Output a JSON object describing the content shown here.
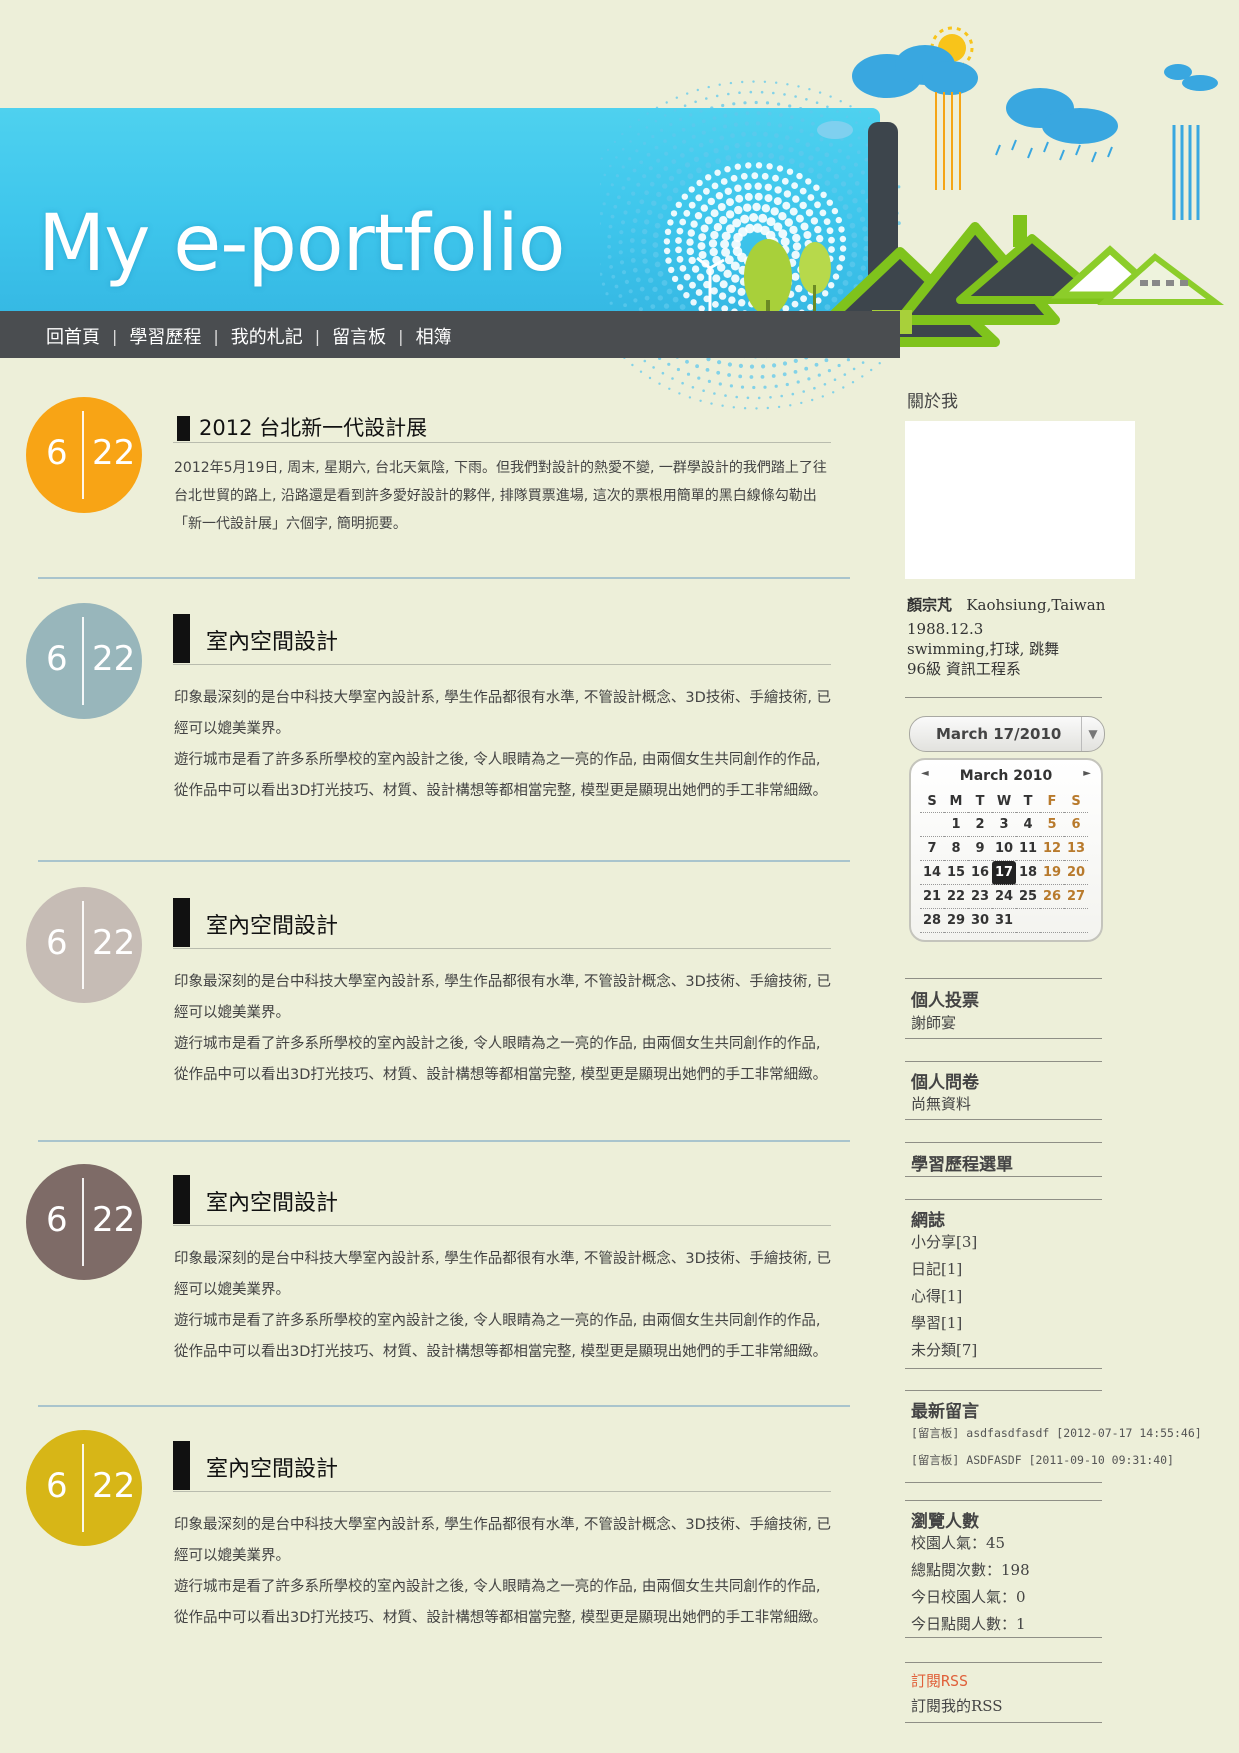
{
  "header": {
    "site_title": "My e-portfolio",
    "nav": [
      "回首頁",
      "學習歷程",
      "我的札記",
      "留言板",
      "相簿"
    ]
  },
  "posts": [
    {
      "month": "6",
      "day": "22",
      "color": "#f8a415",
      "title": "2012 台北新一代設計展",
      "paragraphs": [
        "2012年5月19日, 周末, 星期六, 台北天氣陰, 下雨。但我們對設計的熱愛不變, 一群學設計的我們踏上了往台北世貿的路上, 沿路還是看到許多愛好設計的夥伴, 排隊買票進場, 這次的票根用簡單的黑白線條勾勒出「新一代設計展」六個字, 簡明扼要。"
      ]
    },
    {
      "month": "6",
      "day": "22",
      "color": "#98b6bb",
      "title": "室內空間設計",
      "paragraphs": [
        "印象最深刻的是台中科技大學室內設計系, 學生作品都很有水準, 不管設計概念、3D技術、手繪技術, 已經可以媲美業界。",
        "遊行城市是看了許多系所學校的室內設計之後, 令人眼睛為之一亮的作品, 由兩個女生共同創作的作品, 從作品中可以看出3D打光技巧、材質、設計構想等都相當完整, 模型更是顯現出她們的手工非常細緻。"
      ]
    },
    {
      "month": "6",
      "day": "22",
      "color": "#c6bcb5",
      "title": "室內空間設計",
      "paragraphs": [
        "印象最深刻的是台中科技大學室內設計系, 學生作品都很有水準, 不管設計概念、3D技術、手繪技術, 已經可以媲美業界。",
        "遊行城市是看了許多系所學校的室內設計之後, 令人眼睛為之一亮的作品, 由兩個女生共同創作的作品, 從作品中可以看出3D打光技巧、材質、設計構想等都相當完整, 模型更是顯現出她們的手工非常細緻。"
      ]
    },
    {
      "month": "6",
      "day": "22",
      "color": "#7e6b67",
      "title": "室內空間設計",
      "paragraphs": [
        "印象最深刻的是台中科技大學室內設計系, 學生作品都很有水準, 不管設計概念、3D技術、手繪技術, 已經可以媲美業界。",
        "遊行城市是看了許多系所學校的室內設計之後, 令人眼睛為之一亮的作品, 由兩個女生共同創作的作品, 從作品中可以看出3D打光技巧、材質、設計構想等都相當完整, 模型更是顯現出她們的手工非常細緻。"
      ]
    },
    {
      "month": "6",
      "day": "22",
      "color": "#d7b617",
      "title": "室內空間設計",
      "paragraphs": [
        "印象最深刻的是台中科技大學室內設計系, 學生作品都很有水準, 不管設計概念、3D技術、手繪技術, 已經可以媲美業界。",
        "遊行城市是看了許多系所學校的室內設計之後, 令人眼睛為之一亮的作品, 由兩個女生共同創作的作品, 從作品中可以看出3D打光技巧、材質、設計構想等都相當完整, 模型更是顯現出她們的手工非常細緻。"
      ]
    }
  ],
  "sidebar": {
    "about": {
      "heading": "關於我",
      "name": "顏宗芃",
      "location": "Kaohsiung,Taiwan",
      "birthday": "1988.12.3",
      "hobbies": "swimming,打球, 跳舞",
      "class": "96級  資訊工程系"
    },
    "calendar": {
      "selected": "March 17/2010",
      "month_label": "March 2010",
      "prev": "◄",
      "next": "►",
      "dropdown": "▼",
      "dow": [
        "S",
        "M",
        "T",
        "W",
        "T",
        "F",
        "S"
      ],
      "weeks": [
        [
          "",
          "1",
          "2",
          "3",
          "4",
          "5",
          "6"
        ],
        [
          "7",
          "8",
          "9",
          "10",
          "11",
          "12",
          "13"
        ],
        [
          "14",
          "15",
          "16",
          "17",
          "18",
          "19",
          "20"
        ],
        [
          "21",
          "22",
          "23",
          "24",
          "25",
          "26",
          "27"
        ],
        [
          "28",
          "29",
          "30",
          "31",
          "",
          "",
          ""
        ]
      ],
      "today": "17",
      "weekend_color": "#b87a2c"
    },
    "vote": {
      "heading": "個人投票",
      "text": "謝師宴"
    },
    "survey": {
      "heading": "個人問卷",
      "text": "尚無資料"
    },
    "menu": {
      "heading": "學習歷程選單"
    },
    "blog": {
      "heading": "網誌",
      "items": [
        "小分享[3]",
        "日記[1]",
        "心得[1]",
        "學習[1]",
        "未分類[7]"
      ]
    },
    "messages": {
      "heading": "最新留言",
      "items": [
        "[留言板] asdfasdfasdf [2012-07-17 14:55:46]",
        "[留言板] ASDFASDF [2011-09-10 09:31:40]"
      ]
    },
    "stats": {
      "heading": "瀏覽人數",
      "items": [
        "校園人氣：45",
        "總點閱次數：198",
        "今日校園人氣：0",
        "今日點閱人數：1"
      ]
    },
    "rss": {
      "heading": "訂閱RSS",
      "heading_color": "#e0603a",
      "text": "訂閱我的RSS"
    }
  }
}
